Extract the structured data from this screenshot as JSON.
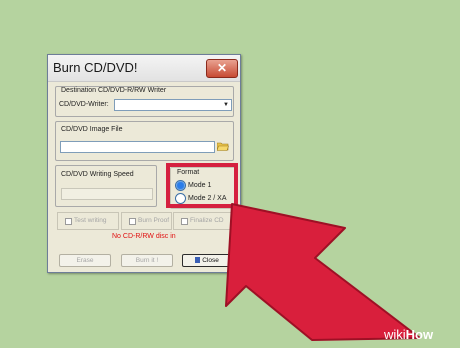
{
  "window": {
    "title": "Burn CD/DVD!",
    "close_label": "✕"
  },
  "destination": {
    "heading": "Destination CD/DVD-R/RW Writer",
    "writer_label": "CD/DVD-Writer:",
    "writer_value": ""
  },
  "image_file": {
    "label": "CD/DVD Image File",
    "path": ""
  },
  "speed": {
    "label": "CD/DVD Writing Speed",
    "value": ""
  },
  "format": {
    "label": "Format",
    "options": [
      "Mode 1",
      "Mode 2 / XA"
    ],
    "selected": "Mode 1"
  },
  "options": {
    "test_writing": "Test writing",
    "burn_proof": "Burn Proof",
    "finalize_cd": "Finalize CD"
  },
  "status_message": "No CD-R/RW disc in",
  "buttons": {
    "erase": "Erase",
    "burn": "Burn it !",
    "close": "Close"
  },
  "watermark": {
    "prefix": "wiki",
    "suffix": "How"
  },
  "colors": {
    "highlight": "#d5203f",
    "arrow": "#d91f3c",
    "background": "#b5d39f",
    "status": "#e01010"
  }
}
